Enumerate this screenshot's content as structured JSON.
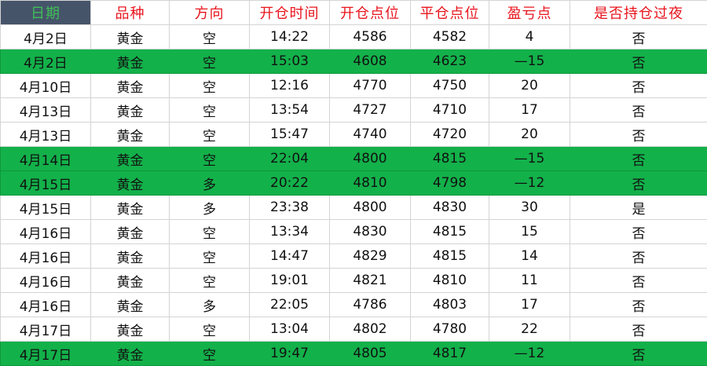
{
  "colors": {
    "header_text": "#e8141c",
    "date_header_bg": "#46546a",
    "date_header_text": "#3fbf57",
    "highlight_row_bg": "#13b14a",
    "grid_line": "#d4d4d4"
  },
  "columns": [
    "日期",
    "品种",
    "方向",
    "开仓时间",
    "开仓点位",
    "平仓点位",
    "盈亏点",
    "是否持仓过夜"
  ],
  "rows": [
    {
      "highlight": false,
      "cells": [
        "4月2日",
        "黄金",
        "空",
        "14:22",
        "4586",
        "4582",
        "4",
        "否"
      ]
    },
    {
      "highlight": true,
      "cells": [
        "4月2日",
        "黄金",
        "空",
        "15:03",
        "4608",
        "4623",
        "—15",
        "否"
      ]
    },
    {
      "highlight": false,
      "cells": [
        "4月10日",
        "黄金",
        "空",
        "12:16",
        "4770",
        "4750",
        "20",
        "否"
      ]
    },
    {
      "highlight": false,
      "cells": [
        "4月13日",
        "黄金",
        "空",
        "13:54",
        "4727",
        "4710",
        "17",
        "否"
      ]
    },
    {
      "highlight": false,
      "cells": [
        "4月13日",
        "黄金",
        "空",
        "15:47",
        "4740",
        "4720",
        "20",
        "否"
      ]
    },
    {
      "highlight": true,
      "cells": [
        "4月14日",
        "黄金",
        "空",
        "22:04",
        "4800",
        "4815",
        "—15",
        "否"
      ]
    },
    {
      "highlight": true,
      "cells": [
        "4月15日",
        "黄金",
        "多",
        "20:22",
        "4810",
        "4798",
        "—12",
        "否"
      ]
    },
    {
      "highlight": false,
      "cells": [
        "4月15日",
        "黄金",
        "多",
        "23:38",
        "4800",
        "4830",
        "30",
        "是"
      ]
    },
    {
      "highlight": false,
      "cells": [
        "4月16日",
        "黄金",
        "空",
        "13:34",
        "4830",
        "4815",
        "15",
        "否"
      ]
    },
    {
      "highlight": false,
      "cells": [
        "4月16日",
        "黄金",
        "空",
        "14:47",
        "4829",
        "4815",
        "14",
        "否"
      ]
    },
    {
      "highlight": false,
      "cells": [
        "4月16日",
        "黄金",
        "空",
        "19:01",
        "4821",
        "4810",
        "11",
        "否"
      ]
    },
    {
      "highlight": false,
      "cells": [
        "4月16日",
        "黄金",
        "多",
        "22:05",
        "4786",
        "4803",
        "17",
        "否"
      ]
    },
    {
      "highlight": false,
      "cells": [
        "4月17日",
        "黄金",
        "空",
        "13:04",
        "4802",
        "4780",
        "22",
        "否"
      ]
    },
    {
      "highlight": true,
      "cells": [
        "4月17日",
        "黄金",
        "空",
        "19:47",
        "4805",
        "4817",
        "—12",
        "否"
      ]
    }
  ]
}
